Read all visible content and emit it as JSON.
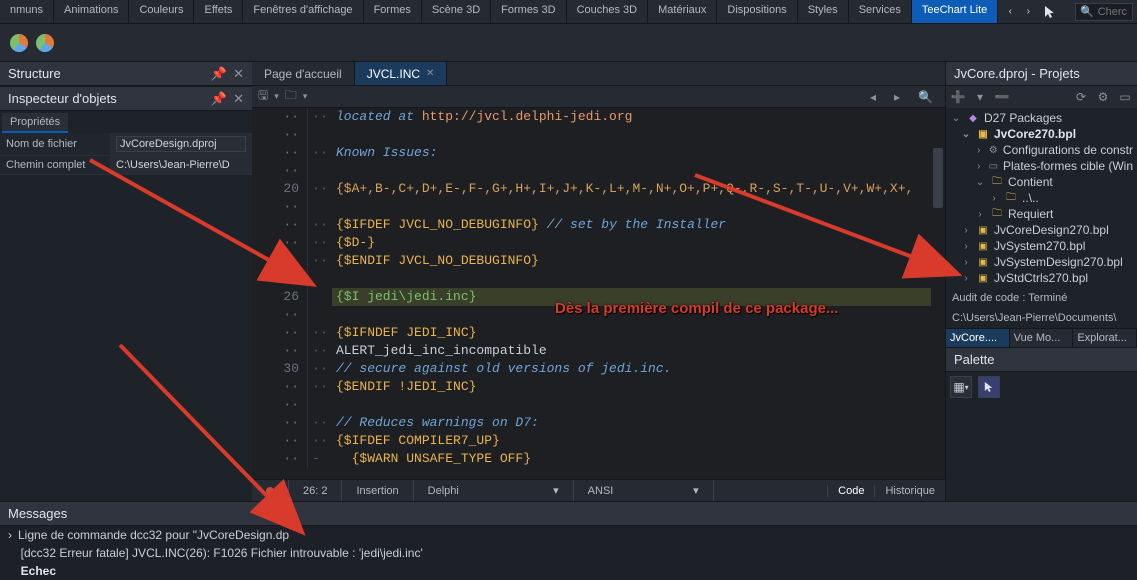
{
  "topbar": {
    "tabs": [
      "nmuns",
      "Animations",
      "Couleurs",
      "Effets",
      "Fenêtres d'affichage",
      "Formes",
      "Scène 3D",
      "Formes 3D",
      "Couches 3D",
      "Matériaux",
      "Dispositions",
      "Styles",
      "Services",
      "TeeChart Lite"
    ],
    "active_tab_index": 13,
    "search_placeholder": "Cherc"
  },
  "left": {
    "structure_title": "Structure",
    "inspector_title": "Inspecteur d'objets",
    "props_tab": "Propriétés",
    "rows": [
      {
        "label": "Nom de fichier",
        "value": "JvCoreDesign.dproj"
      },
      {
        "label": "Chemin complet",
        "value": "C:\\Users\\Jean-Pierre\\D"
      }
    ]
  },
  "editor": {
    "tabs": [
      {
        "label": "Page d'accueil",
        "closable": false,
        "active": false
      },
      {
        "label": "JVCL.INC",
        "closable": true,
        "active": true
      }
    ],
    "status": {
      "pos": "26: 2",
      "mode": "Insertion",
      "lang": "Delphi",
      "enc": "ANSI",
      "view_code": "Code",
      "view_hist": "Historique"
    },
    "code": {
      "lines": [
        {
          "g": "··",
          "d": "··",
          "html": "<span class='c-cmnt'>located at </span><span class='c-ref'>http://jvcl.delphi-jedi.org</span>"
        },
        {
          "g": "··",
          "d": "",
          "html": ""
        },
        {
          "g": "··",
          "d": "··",
          "html": "<span class='c-cmnt'>Known Issues:</span>"
        },
        {
          "g": "··",
          "d": "",
          "html": ""
        },
        {
          "g": "20",
          "d": "··",
          "html": "<span class='c-txt'>{$A+,B-,C+,D+,E-,F-,G+,H+,I+,J+,K-,L+,M-,N+,O+,P+,Q-,R-,S-,T-,U-,V+,W+,X+,</span>"
        },
        {
          "g": "··",
          "d": "",
          "html": ""
        },
        {
          "g": "··",
          "d": "··",
          "html": "<span class='c-kw'>{$IFDEF JVCL_NO_DEBUGINFO}</span> <span class='c-cmnt'>// set by the Installer</span>"
        },
        {
          "g": "··",
          "d": "··",
          "html": "<span class='c-kw'>{$D-}</span>"
        },
        {
          "g": "··",
          "d": "··",
          "html": "<span class='c-kw'>{$ENDIF JVCL_NO_DEBUGINFO}</span>"
        },
        {
          "g": "··",
          "d": "",
          "html": ""
        },
        {
          "g": "26",
          "d": "",
          "html": "",
          "hl": true,
          "hltext": "{$I jedi\\jedi.inc}"
        },
        {
          "g": "··",
          "d": "",
          "html": ""
        },
        {
          "g": "··",
          "d": "··",
          "html": "<span class='c-kw'>{$IFNDEF JEDI_INC}</span>"
        },
        {
          "g": "··",
          "d": "··",
          "html": "ALERT_jedi_inc_incompatible"
        },
        {
          "g": "30",
          "d": "··",
          "html": "<span class='c-cmnt'>// secure against old versions of jedi.inc.</span>"
        },
        {
          "g": "··",
          "d": "··",
          "html": "<span class='c-kw'>{$ENDIF !JEDI_INC}</span>"
        },
        {
          "g": "··",
          "d": "",
          "html": ""
        },
        {
          "g": "··",
          "d": "··",
          "html": "<span class='c-cmnt'>// Reduces warnings on D7:</span>"
        },
        {
          "g": "··",
          "d": "··",
          "html": "<span class='c-kw'>{$IFDEF COMPILER7_UP}</span>"
        },
        {
          "g": "··",
          "d": "- ",
          "html": "  <span class='c-kw'>{$WARN UNSAFE_TYPE OFF}</span>"
        }
      ]
    }
  },
  "right": {
    "title": "JvCore.dproj - Projets",
    "tree": [
      {
        "ind": 0,
        "tw": "⌄",
        "icon": "◆",
        "iclass": "fpurple",
        "label": "D27 Packages"
      },
      {
        "ind": 1,
        "tw": "⌄",
        "icon": "▣",
        "iclass": "fyellow",
        "label": "JvCore270.bpl",
        "bold": true
      },
      {
        "ind": 2,
        "tw": "›",
        "icon": "⚙",
        "iclass": "fgrey",
        "label": "Configurations de constr"
      },
      {
        "ind": 2,
        "tw": "›",
        "icon": "▭",
        "iclass": "fgrey",
        "label": "Plates-formes cible (Win"
      },
      {
        "ind": 2,
        "tw": "⌄",
        "icon": "🗀",
        "iclass": "fyellow",
        "label": "Contient"
      },
      {
        "ind": 3,
        "tw": "›",
        "icon": "🗀",
        "iclass": "fyellow",
        "label": "..\\.."
      },
      {
        "ind": 2,
        "tw": "›",
        "icon": "🗀",
        "iclass": "fyellow",
        "label": "Requiert"
      },
      {
        "ind": 1,
        "tw": "›",
        "icon": "▣",
        "iclass": "fyellow",
        "label": "JvCoreDesign270.bpl"
      },
      {
        "ind": 1,
        "tw": "›",
        "icon": "▣",
        "iclass": "fyellow",
        "label": "JvSystem270.bpl"
      },
      {
        "ind": 1,
        "tw": "›",
        "icon": "▣",
        "iclass": "fyellow",
        "label": "JvSystemDesign270.bpl"
      },
      {
        "ind": 1,
        "tw": "›",
        "icon": "▣",
        "iclass": "fyellow",
        "label": "JvStdCtrls270.bpl"
      }
    ],
    "audit": "Audit de code : Terminé",
    "path": "C:\\Users\\Jean-Pierre\\Documents\\",
    "subtabs": [
      "JvCore....",
      "Vue Mo...",
      "Explorat..."
    ],
    "subtabs_active": 0,
    "palette_title": "Palette"
  },
  "messages": {
    "title": "Messages",
    "rows": [
      {
        "expand": true,
        "text": "Ligne de commande dcc32 pour \"JvCoreDesign.dp"
      },
      {
        "expand": false,
        "text": "[dcc32 Erreur fatale] JVCL.INC(26): F1026 Fichier introuvable : 'jedi\\jedi.inc'"
      },
      {
        "expand": false,
        "text": "Echec",
        "bold": true
      }
    ]
  },
  "annotation": {
    "text": "Dès la première compil de ce package..."
  }
}
